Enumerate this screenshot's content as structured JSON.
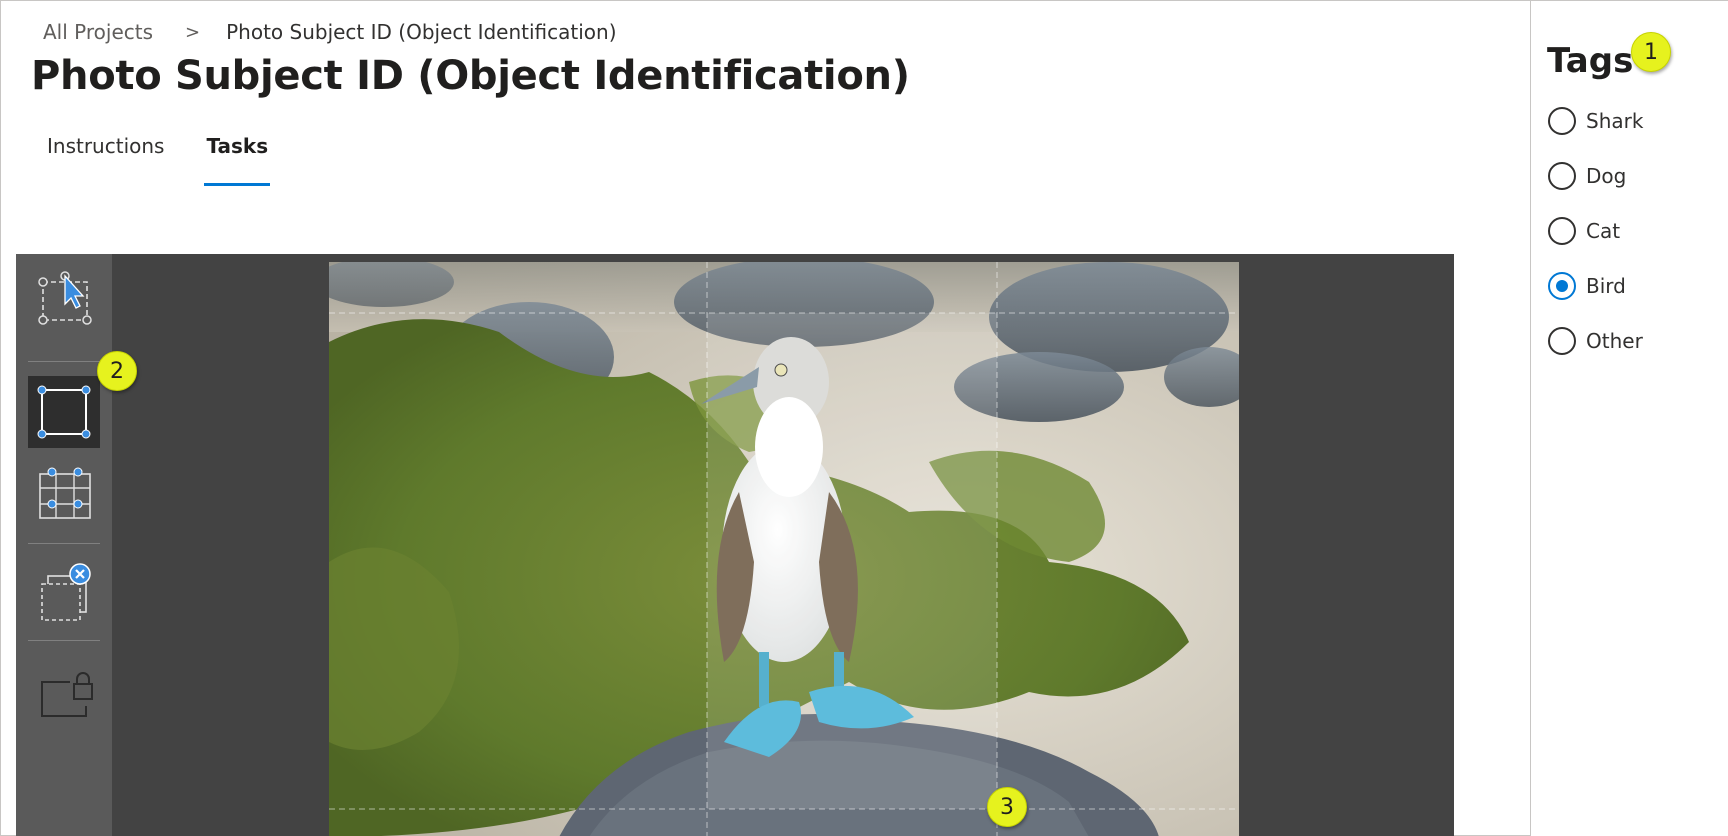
{
  "breadcrumb": {
    "root": "All Projects",
    "separator": ">",
    "current": "Photo Subject ID (Object Identification)"
  },
  "page_title": "Photo Subject ID (Object Identification)",
  "tabs": [
    {
      "label": "Instructions",
      "active": false
    },
    {
      "label": "Tasks",
      "active": true
    }
  ],
  "tags": {
    "title": "Tags",
    "items": [
      {
        "label": "Shark",
        "checked": false
      },
      {
        "label": "Dog",
        "checked": false
      },
      {
        "label": "Cat",
        "checked": false
      },
      {
        "label": "Bird",
        "checked": true
      },
      {
        "label": "Other",
        "checked": false
      }
    ]
  },
  "toolbar": {
    "tools": [
      {
        "name": "select-tool",
        "icon": "select-cursor-icon",
        "selected": false
      },
      {
        "name": "rectangle-tool",
        "icon": "rectangle-icon",
        "selected": true
      },
      {
        "name": "auto-region-tool",
        "icon": "region-grid-icon",
        "selected": false
      },
      {
        "name": "delete-regions-tool",
        "icon": "delete-regions-icon",
        "selected": false
      },
      {
        "name": "lock-tool",
        "icon": "lock-regions-icon",
        "selected": false
      }
    ]
  },
  "image": {
    "subject": "blue-footed booby"
  },
  "callouts": [
    "1",
    "2",
    "3"
  ],
  "colors": {
    "accent": "#0078d4",
    "workspace_bg": "#434343",
    "toolbar_bg": "#5a5a5a",
    "callout": "#e6f21e"
  }
}
